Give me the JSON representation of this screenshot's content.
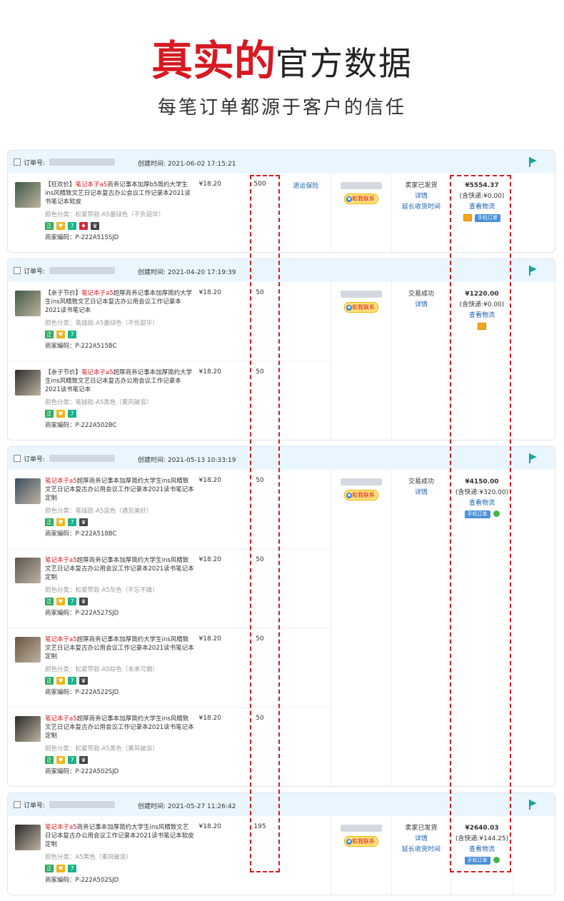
{
  "hero": {
    "red": "真实的",
    "black": "官方数据",
    "sub": "每笔订单都源于客户的信任"
  },
  "labels": {
    "order_no": "订单号:",
    "created": "创建时间:",
    "contact": "和我联系",
    "unit": "¥"
  },
  "colors": {
    "accent": "#d71921",
    "link": "#1a5fb4",
    "header_bg": "#eaf6fd"
  },
  "orders": [
    {
      "created": "创建时间: 2021-06-02 17:15:21",
      "status": [
        "卖家已发货",
        "详情",
        "延长收货时间"
      ],
      "total": "¥5554.37",
      "ship": "(含快递:¥0.00)",
      "logistics": "查看物流",
      "mobile": "手机订单",
      "items": [
        {
          "tag": "【狂欢价】",
          "kw": "笔记本子a5",
          "title": "商务记事本加厚b5简约大学生ins风精致文艺日记本复古办公会议工作记录本2021读书笔记本软皮",
          "sku": "颜色分类：松紧带款-A5墨绿色（不负韶华）",
          "code": "商家编码：P-222A515SJD",
          "price": "¥18.20",
          "qty": "500",
          "service": "退运保险",
          "thumb": "#3d5b47"
        }
      ]
    },
    {
      "created": "创建时间: 2021-04-20 17:19:39",
      "status": [
        "交易成功",
        "详情"
      ],
      "total": "¥1220.00",
      "ship": "(含快递:¥0.00)",
      "logistics": "查看物流",
      "items": [
        {
          "tag": "【亲子节价】",
          "kw": "笔记本子a5",
          "title": "超厚商务记事本加厚简约大学生ins风精致文艺日记本复古办公用会议工作记录本2021读书笔记本",
          "sku": "颜色分类：笔插款-A5墨绿色（不负韶华）",
          "code": "商家编码：P-222A515BC",
          "price": "¥18.20",
          "qty": "50",
          "thumb": "#3f5a44"
        },
        {
          "tag": "【亲子节价】",
          "kw": "笔记本子a5",
          "title": "超厚商务记事本加厚简约大学生ins风精致文艺日记本复古办公用会议工作记录本2021读书笔记本",
          "sku": "颜色分类：笔插款-A5黑色（乘风破浪）",
          "code": "商家编码：P-222A502BC",
          "price": "¥18.20",
          "qty": "50",
          "thumb": "#2d2d2d"
        }
      ]
    },
    {
      "created": "创建时间: 2021-05-13 10:33:19",
      "status": [
        "交易成功",
        "详情"
      ],
      "total": "¥4150.00",
      "ship": "(含快递:¥320.00)",
      "logistics": "查看物流",
      "mobile": "手机订单",
      "items": [
        {
          "tag": "",
          "kw": "笔记本子a5",
          "title": "超厚商务记事本加厚简约大学生ins风精致文艺日记本复古办公用会议工作记录本2021读书笔记本定制",
          "sku": "颜色分类：笔插款-A5蓝色（遇见美好）",
          "code": "商家编码：P-222A518BC",
          "price": "¥18.20",
          "qty": "50",
          "thumb": "#3a4d63"
        },
        {
          "tag": "",
          "kw": "笔记本子a5",
          "title": "超厚商务记事本加厚简约大学生ins风精致文艺日记本复古办公用会议工作记录本2021读书笔记本定制",
          "sku": "颜色分类：松紧带款-A5灰色（不忘不躁）",
          "code": "商家编码：P-222A527SJD",
          "price": "¥18.20",
          "qty": "50",
          "thumb": "#5b5651"
        },
        {
          "tag": "",
          "kw": "笔记本子a5",
          "title": "超厚商务记事本加厚简约大学生ins风精致文艺日记本复古办公用会议工作记录本2021读书笔记本定制",
          "sku": "颜色分类：松紧带款-A5棕色（未来可期）",
          "code": "商家编码：P-222A522SJD",
          "price": "¥18.20",
          "qty": "50",
          "thumb": "#6a5444"
        },
        {
          "tag": "",
          "kw": "笔记本子a5",
          "title": "超厚商务记事本加厚简约大学生ins风精致文艺日记本复古办公用会议工作记录本2021读书笔记本定制",
          "sku": "颜色分类：松紧带款-A5黑色（乘风破浪）",
          "code": "商家编码：P-222A502SJD",
          "price": "¥18.20",
          "qty": "50",
          "thumb": "#2b2b2b"
        }
      ]
    },
    {
      "created": "创建时间: 2021-05-27 11:26:42",
      "status": [
        "卖家已发货",
        "详情",
        "延长收货时间"
      ],
      "total": "¥2640.03",
      "ship": "(含快递:¥144.25)",
      "logistics": "查看物流",
      "mobile": "手机订单",
      "items": [
        {
          "tag": "",
          "kw": "笔记本子a5",
          "title": "商务记事本加厚简约大学生ins风精致文艺日记本复古办公用会议工作记录本2021读书笔记本软皮定制",
          "sku": "颜色分类：A5黑色（乘风破浪）",
          "code": "商家编码：P-222A502SJD",
          "price": "¥18.20",
          "qty": "195",
          "thumb": "#2a2a2a"
        }
      ]
    }
  ]
}
